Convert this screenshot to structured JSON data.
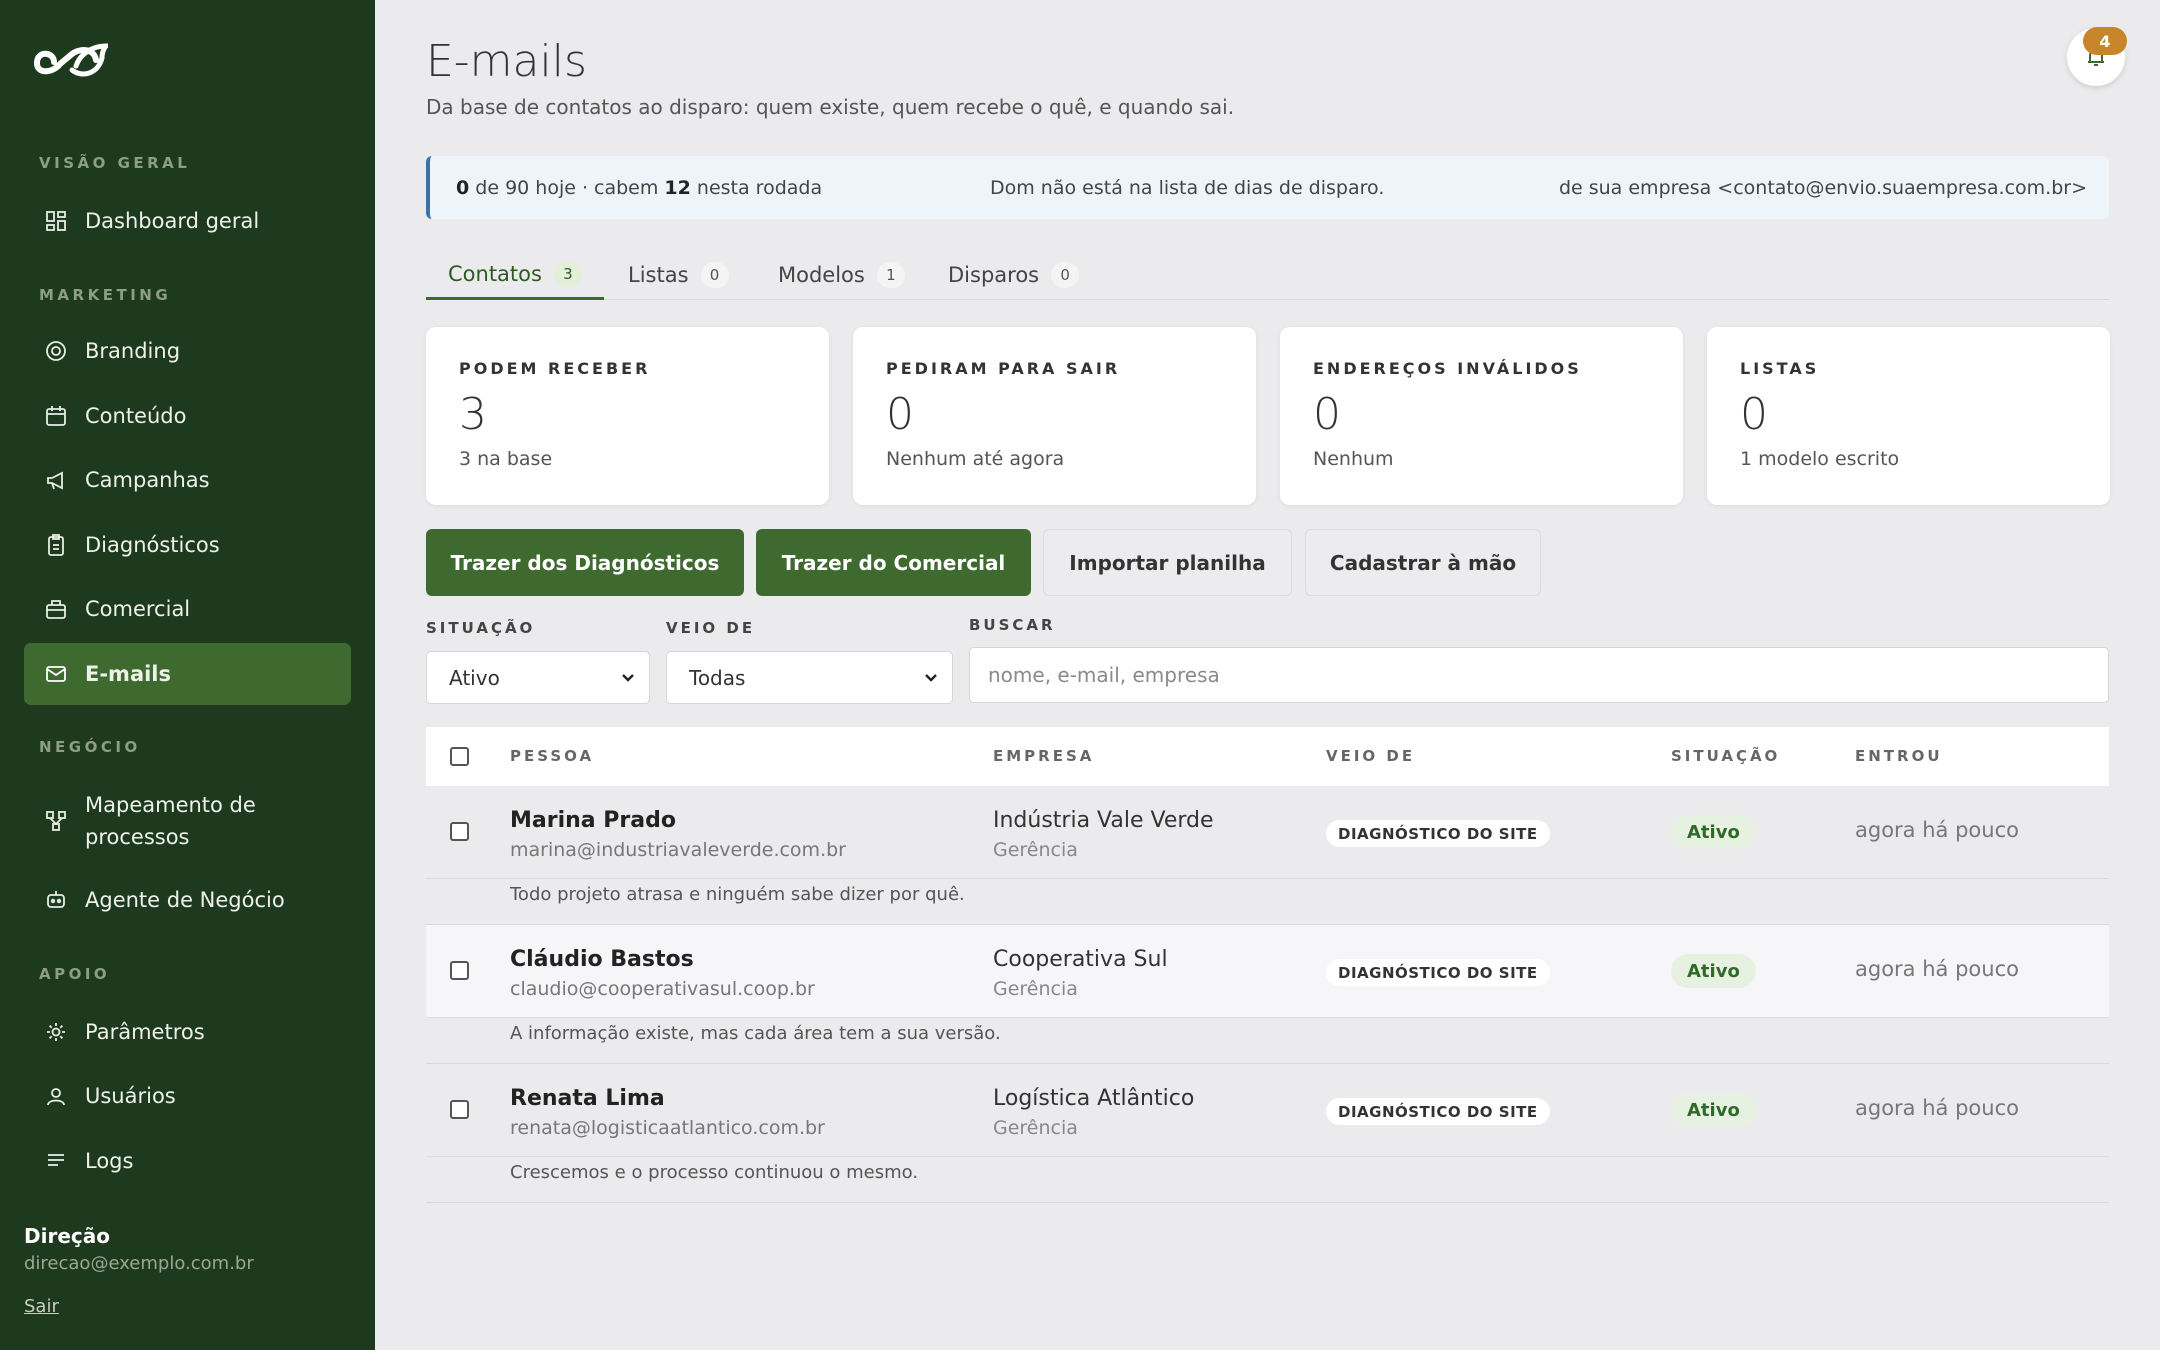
{
  "sidebar": {
    "sections": [
      "VISÃO GERAL",
      "MARKETING",
      "NEGÓCIO",
      "APOIO"
    ],
    "items": [
      {
        "label": "Dashboard geral",
        "icon": "grid-icon"
      },
      {
        "label": "Branding",
        "icon": "target-icon"
      },
      {
        "label": "Conteúdo",
        "icon": "calendar-icon"
      },
      {
        "label": "Campanhas",
        "icon": "megaphone-icon"
      },
      {
        "label": "Diagnósticos",
        "icon": "clipboard-icon"
      },
      {
        "label": "Comercial",
        "icon": "briefcase-icon"
      },
      {
        "label": "E-mails",
        "icon": "mail-icon",
        "active": true
      },
      {
        "label": "Mapeamento de processos",
        "icon": "flow-icon"
      },
      {
        "label": "Agente de Negócio",
        "icon": "bot-icon"
      },
      {
        "label": "Parâmetros",
        "icon": "gear-icon"
      },
      {
        "label": "Usuários",
        "icon": "user-icon"
      },
      {
        "label": "Logs",
        "icon": "list-icon"
      }
    ],
    "user": {
      "name": "Direção",
      "email": "direcao@exemplo.com.br",
      "logout": "Sair"
    }
  },
  "header": {
    "title": "E-mails",
    "subtitle": "Da base de contatos ao disparo: quem existe, quem recebe o quê, e quando sai.",
    "notifications": "4"
  },
  "info": {
    "count_today": "0",
    "text_a1": " de 90 hoje · cabem ",
    "fit": "12",
    "text_a2": " nesta rodada",
    "schedule": "Dom não está na lista de dias de disparo.",
    "sender": "de sua empresa <contato@envio.suaempresa.com.br>"
  },
  "tabs": [
    {
      "label": "Contatos",
      "count": "3"
    },
    {
      "label": "Listas",
      "count": "0"
    },
    {
      "label": "Modelos",
      "count": "1"
    },
    {
      "label": "Disparos",
      "count": "0"
    }
  ],
  "cards": [
    {
      "label": "PODEM RECEBER",
      "value": "3",
      "sub": "3 na base"
    },
    {
      "label": "PEDIRAM PARA SAIR",
      "value": "0",
      "sub": "Nenhum até agora"
    },
    {
      "label": "ENDEREÇOS INVÁLIDOS",
      "value": "0",
      "sub": "Nenhum"
    },
    {
      "label": "LISTAS",
      "value": "0",
      "sub": "1 modelo escrito"
    }
  ],
  "actions": {
    "from_diagnostics": "Trazer dos Diagnósticos",
    "from_commercial": "Trazer do Comercial",
    "import_sheet": "Importar planilha",
    "manual": "Cadastrar à mão"
  },
  "filters": {
    "status_label": "SITUAÇÃO",
    "status_value": "Ativo",
    "origin_label": "VEIO DE",
    "origin_value": "Todas",
    "search_label": "BUSCAR",
    "search_placeholder": "nome, e-mail, empresa"
  },
  "table": {
    "headers": [
      "PESSOA",
      "EMPRESA",
      "VEIO DE",
      "SITUAÇÃO",
      "ENTROU"
    ],
    "rows": [
      {
        "name": "Marina Prado",
        "email": "marina@industriavaleverde.com.br",
        "company": "Indústria Vale Verde",
        "role": "Gerência",
        "origin": "DIAGNÓSTICO DO SITE",
        "status": "Ativo",
        "entered": "agora há pouco",
        "note": "Todo projeto atrasa e ninguém sabe dizer por quê."
      },
      {
        "name": "Cláudio Bastos",
        "email": "claudio@cooperativasul.coop.br",
        "company": "Cooperativa Sul",
        "role": "Gerência",
        "origin": "DIAGNÓSTICO DO SITE",
        "status": "Ativo",
        "entered": "agora há pouco",
        "note": "A informação existe, mas cada área tem a sua versão."
      },
      {
        "name": "Renata Lima",
        "email": "renata@logisticaatlantico.com.br",
        "company": "Logística Atlântico",
        "role": "Gerência",
        "origin": "DIAGNÓSTICO DO SITE",
        "status": "Ativo",
        "entered": "agora há pouco",
        "note": "Crescemos e o processo continuou o mesmo."
      }
    ]
  },
  "colors": {
    "sidebar": "#1e3a1e",
    "accent": "#3e6a2f",
    "badge": "#c7862a",
    "info_border": "#3a73a8"
  }
}
